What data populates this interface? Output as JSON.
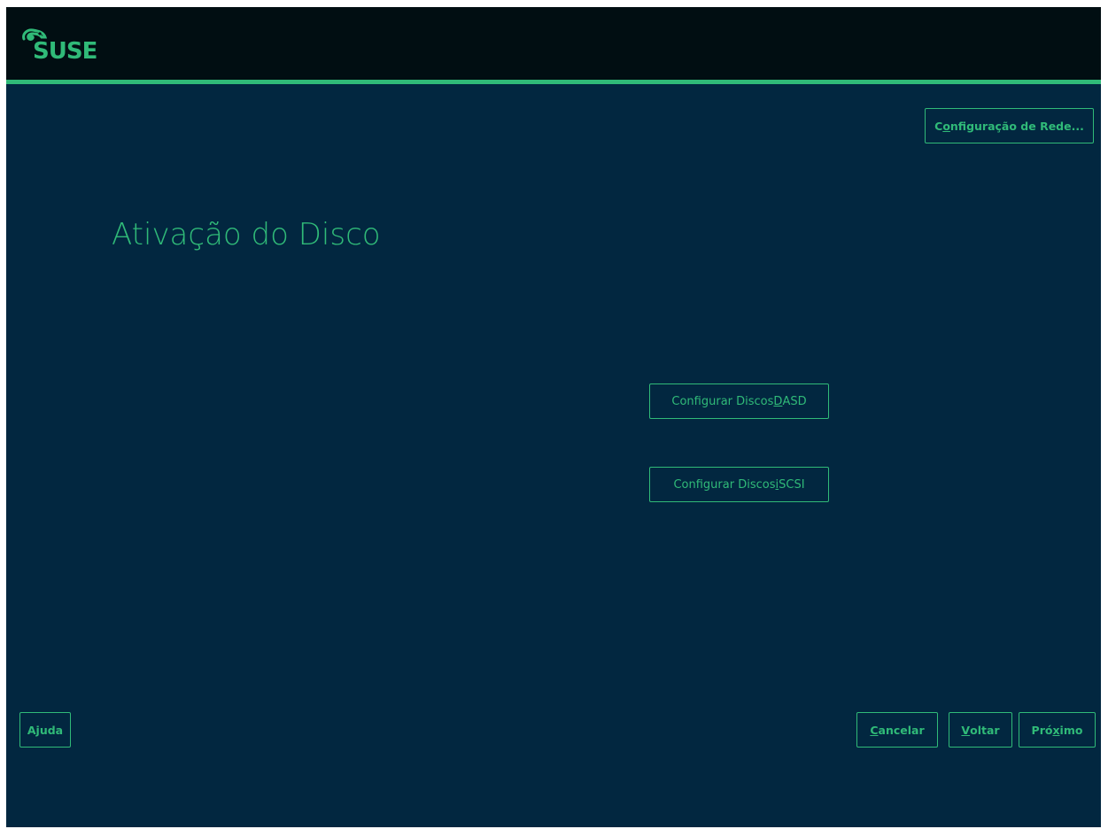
{
  "brand": {
    "logo_text": "SUSE",
    "accent_color": "#30ba78",
    "background_color": "#022740",
    "topbar_color": "#010e12",
    "logo_icon": "chameleon-icon"
  },
  "header": {
    "network_button": {
      "before": "C",
      "key": "o",
      "after": "nfiguração de Rede..."
    }
  },
  "main": {
    "title": "Ativação do Disco",
    "dasd_button": {
      "before": "Configurar Discos ",
      "key": "D",
      "after": "ASD"
    },
    "iscsi_button": {
      "before": "Configurar Discos ",
      "key": "i",
      "after": "SCSI"
    }
  },
  "footer": {
    "help_button": {
      "before": "",
      "key": "",
      "after": "Ajuda"
    },
    "cancel_button": {
      "before": "",
      "key": "C",
      "after": "ancelar"
    },
    "back_button": {
      "before": "",
      "key": "V",
      "after": "oltar"
    },
    "next_button": {
      "before": "Pró",
      "key": "x",
      "after": "imo"
    }
  }
}
